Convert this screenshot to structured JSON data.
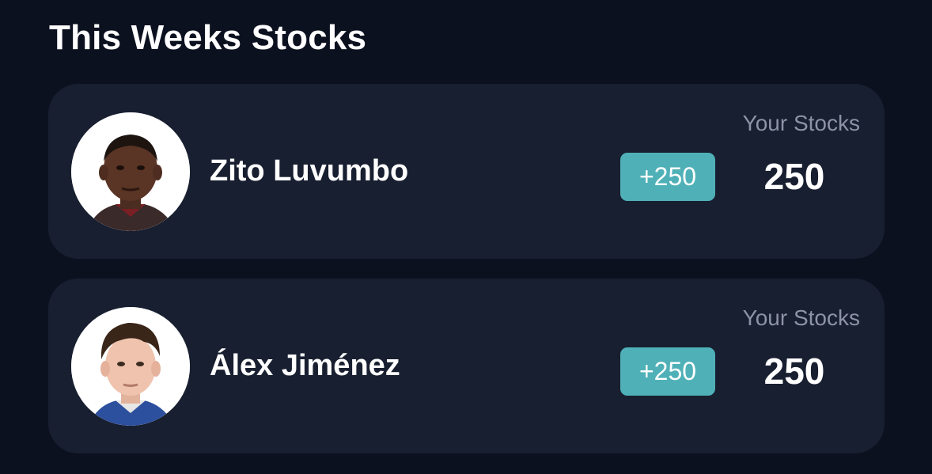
{
  "section": {
    "title": "This Weeks Stocks"
  },
  "players": [
    {
      "name": "Zito Luvumbo",
      "stocks_label": "Your Stocks",
      "change": "+250",
      "stocks": "250",
      "avatar_icon": "player-photo"
    },
    {
      "name": "Álex Jiménez",
      "stocks_label": "Your Stocks",
      "change": "+250",
      "stocks": "250",
      "avatar_icon": "player-photo"
    }
  ],
  "colors": {
    "background": "#0c1120",
    "card": "#181f30",
    "badge": "#4fb1b7",
    "label": "#8d93a6",
    "text": "#ffffff"
  }
}
